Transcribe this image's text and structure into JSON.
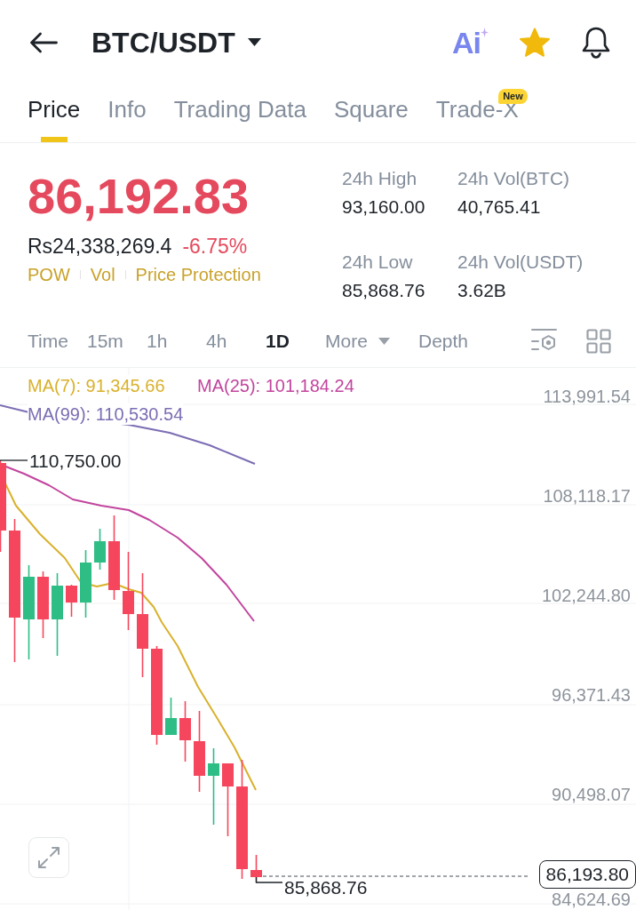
{
  "header": {
    "title": "BTC/USDT",
    "ai_label": "Ai",
    "favorite": true
  },
  "tabs": [
    {
      "label": "Price",
      "selected": true
    },
    {
      "label": "Info",
      "selected": false
    },
    {
      "label": "Trading Data",
      "selected": false
    },
    {
      "label": "Square",
      "selected": false
    },
    {
      "label": "Trade-X",
      "selected": false,
      "badge": "New"
    }
  ],
  "ticker": {
    "last_price": "86,192.83",
    "fiat_price": "Rs24,338,269.4",
    "change": "-6.75%",
    "tags": [
      "POW",
      "Vol",
      "Price Protection"
    ],
    "stats": [
      {
        "label": "24h High",
        "value": "93,160.00"
      },
      {
        "label": "24h Vol(BTC)",
        "value": "40,765.41"
      },
      {
        "label": "24h Low",
        "value": "85,868.76"
      },
      {
        "label": "24h Vol(USDT)",
        "value": "3.62B"
      }
    ]
  },
  "intervals": [
    {
      "label": "Time",
      "kind": "tab",
      "selected": false
    },
    {
      "label": "15m",
      "kind": "tab",
      "selected": false
    },
    {
      "label": "1h",
      "kind": "tab",
      "selected": false
    },
    {
      "label": "4h",
      "kind": "tab",
      "selected": false
    },
    {
      "label": "1D",
      "kind": "tab",
      "selected": true
    },
    {
      "label": "More",
      "kind": "dropdown",
      "selected": false
    },
    {
      "label": "Depth",
      "kind": "tab",
      "selected": false
    }
  ],
  "chart": {
    "indicators": [
      {
        "label": "MA(7): 91,345.66",
        "color": "#d9b12c"
      },
      {
        "label": "MA(25): 101,184.24",
        "color": "#c2459e"
      },
      {
        "label": "MA(99): 110,530.54",
        "color": "#7c6db3"
      }
    ],
    "y_axis_labels": [
      "113,991.54",
      "108,118.17",
      "102,244.80",
      "96,371.43",
      "90,498.07",
      "84,624.69"
    ],
    "high_label": "110,750.00",
    "low_label": "85,868.76",
    "current_price": "86,193.80"
  }
}
